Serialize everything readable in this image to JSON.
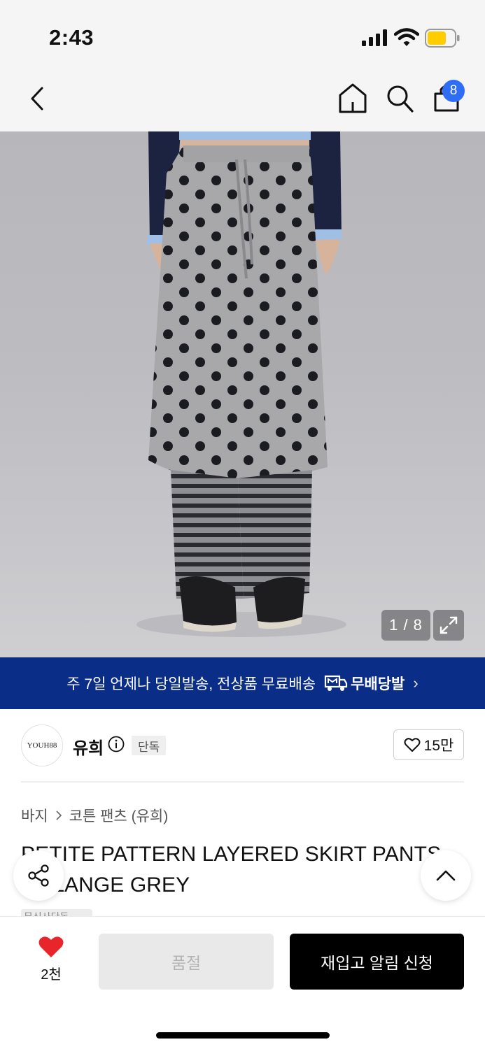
{
  "status_bar": {
    "time": "2:43",
    "signal_icon": "signal-icon",
    "wifi_icon": "wifi-icon",
    "battery_icon": "battery-icon",
    "battery_color": "#ffcc00"
  },
  "nav": {
    "back_icon": "chevron-left-icon",
    "home_icon": "home-icon",
    "search_icon": "search-icon",
    "cart_icon": "shopping-bag-icon",
    "cart_count": "8",
    "badge_color": "#2f6df6"
  },
  "gallery": {
    "counter": "1 / 8",
    "expand_icon": "expand-icon"
  },
  "banner": {
    "text": "주 7일 언제나 당일발송, 전상품 무료배송",
    "logo_label": "무배당발",
    "background": "#0a2d87"
  },
  "brand": {
    "logo_text": "YOUH88",
    "name": "유희",
    "info_icon": "info-icon",
    "tag": "단독",
    "like_count": "15만"
  },
  "product": {
    "breadcrumb": [
      "바지",
      "코튼 팬츠 (유희)"
    ],
    "title": "PETITE PATTERN LAYERED SKIRT PANTS MELANGE GREY",
    "tag_strip": "무신사단독"
  },
  "fab": {
    "share_icon": "share-icon",
    "top_icon": "chevron-up-icon"
  },
  "bottom": {
    "heart_count": "2천",
    "heart_color": "#e8252b",
    "soldout_label": "품절",
    "restock_label": "재입고 알림 신청"
  }
}
